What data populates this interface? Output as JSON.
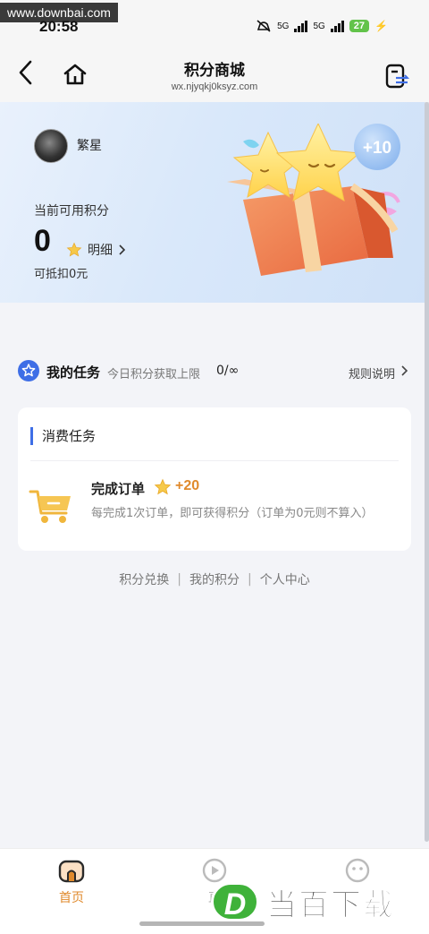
{
  "status_bar": {
    "watermark": "www.downbai.com",
    "time": "20:58",
    "network_1": "5G",
    "network_2": "5G",
    "battery": "27"
  },
  "nav": {
    "title": "积分商城",
    "url": "wx.njyqkj0ksyz.com",
    "icons": [
      "back-icon",
      "home-icon",
      "exchange-icon"
    ]
  },
  "hero": {
    "user_name": "繁星",
    "points_label": "当前可用积分",
    "points_value": "0",
    "detail_label": "明细",
    "points_deduct": "可抵扣0元",
    "gift_badge": "+10"
  },
  "tasks": {
    "title": "我的任务",
    "limit_label": "今日积分获取上限",
    "limit_value": "0/∞",
    "rules_label": "规则说明",
    "card": {
      "section_title": "消费任务",
      "items": [
        {
          "title": "完成订单",
          "bonus": "+20",
          "description": "每完成1次订单，即可获得积分（订单为0元则不算入）"
        }
      ]
    }
  },
  "footer_links": {
    "exchange": "积分兑换",
    "my_points": "我的积分",
    "personal_center": "个人中心"
  },
  "tab_bar": {
    "home": "首页",
    "live": "直"
  },
  "bottom_watermark": {
    "letter": "D",
    "text": "当百下载"
  },
  "colors": {
    "accent_orange": "#e08a2c",
    "section_blue": "#3e6ee6",
    "hero_bg": "#d9e8fa"
  }
}
